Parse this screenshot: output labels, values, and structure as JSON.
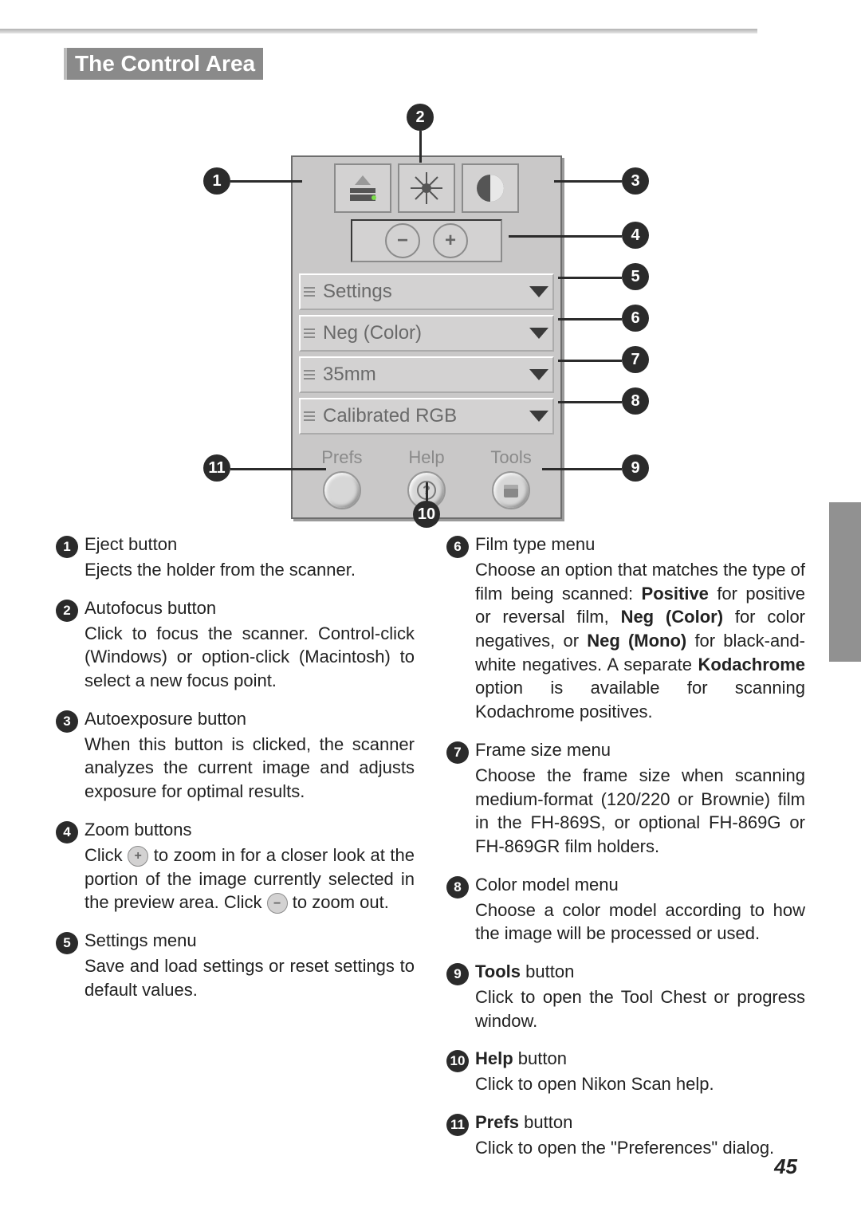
{
  "page_title": "The Control Area",
  "page_number": "45",
  "panel": {
    "dropdowns": {
      "settings": "Settings",
      "film_type": "Neg (Color)",
      "frame_size": "35mm",
      "color_model": "Calibrated RGB"
    },
    "bottom": {
      "prefs": "Prefs",
      "help": "Help",
      "tools": "Tools"
    }
  },
  "callouts": {
    "b1": "1",
    "b2": "2",
    "b3": "3",
    "b4": "4",
    "b5": "5",
    "b6": "6",
    "b7": "7",
    "b8": "8",
    "b9": "9",
    "b10": "10",
    "b11": "11"
  },
  "items_left": [
    {
      "n": "1",
      "title": "Eject button",
      "body": "Ejects the holder from the scanner."
    },
    {
      "n": "2",
      "title": "Autofocus button",
      "body": "Click to focus the scanner.  Control-click (Windows) or option-click (Macintosh) to select a new focus point."
    },
    {
      "n": "3",
      "title": "Autoexposure button",
      "body": "When this button is clicked, the scanner analyzes the current image and adjusts exposure for optimal results."
    },
    {
      "n": "4",
      "title": "Zoom buttons",
      "body_before": "Click ",
      "body_mid": " to zoom in for a closer look at the portion of the image currently selected in the preview area.  Click ",
      "body_after": " to zoom out."
    },
    {
      "n": "5",
      "title": "Settings menu",
      "body": "Save and load settings or reset settings to default values."
    }
  ],
  "items_right": [
    {
      "n": "6",
      "title": "Film type menu",
      "body": "Choose an option that matches the type of film being scanned: <b>Positive</b> for positive or reversal film, <b>Neg (Color)</b> for color negatives, or <b>Neg (Mono)</b> for black-and-white negatives.  A separate <b>Koda­chrome</b> option is available for scanning Kodachrome positives."
    },
    {
      "n": "7",
      "title": "Frame size menu",
      "body": "Choose the frame size when scanning medium-format (120/220 or Brownie) film in the FH-869S, or optional FH-869G or FH-869GR film holders."
    },
    {
      "n": "8",
      "title": "Color model menu",
      "body": "Choose a color model according to how the image will be processed or used."
    },
    {
      "n": "9",
      "title_html": "<b>Tools</b> button",
      "body": "Click to open the Tool Chest or progress window."
    },
    {
      "n": "10",
      "title_html": "<b>Help</b> button",
      "body": "Click to open Nikon Scan help."
    },
    {
      "n": "11",
      "title_html": "<b>Prefs</b> button",
      "body": "Click to open the \"Preferences\" dialog."
    }
  ]
}
